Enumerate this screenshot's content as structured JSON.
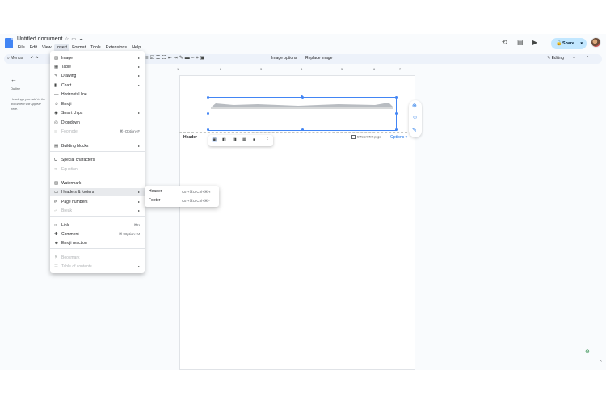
{
  "doc": {
    "title": "Untitled document"
  },
  "menubar": [
    "File",
    "Edit",
    "View",
    "Insert",
    "Format",
    "Tools",
    "Extensions",
    "Help"
  ],
  "share": {
    "label": "Share"
  },
  "toolbar": {
    "menus_label": "Menus",
    "image_options": "Image options",
    "replace_image": "Replace image",
    "mode": "Editing"
  },
  "outline": {
    "label": "Outline",
    "hint": "Headings you add to the document will appear here."
  },
  "ruler": [
    "1",
    "2",
    "3",
    "4",
    "5",
    "6",
    "7"
  ],
  "header_area": {
    "label": "Header",
    "different_first_page": "Different first page",
    "options": "Options"
  },
  "insert_menu": {
    "items": [
      {
        "label": "Image",
        "icon": "image-icon",
        "submenu": true
      },
      {
        "label": "Table",
        "icon": "table-icon",
        "submenu": true
      },
      {
        "label": "Drawing",
        "icon": "drawing-icon",
        "submenu": true
      },
      {
        "label": "Chart",
        "icon": "chart-icon",
        "submenu": true
      },
      {
        "label": "Horizontal line",
        "icon": "horizontal-line-icon"
      },
      {
        "label": "Emoji",
        "icon": "emoji-icon"
      },
      {
        "label": "Smart chips",
        "icon": "smart-chips-icon",
        "submenu": true
      },
      {
        "label": "Dropdown",
        "icon": "dropdown-icon"
      },
      {
        "label": "Footnote",
        "icon": "footnote-icon",
        "shortcut": "⌘+Option+F",
        "disabled": true
      },
      {
        "label": "Building blocks",
        "icon": "building-blocks-icon",
        "submenu": true
      },
      {
        "label": "Special characters",
        "icon": "special-characters-icon"
      },
      {
        "label": "Equation",
        "icon": "equation-icon",
        "disabled": true
      },
      {
        "label": "Watermark",
        "icon": "watermark-icon"
      },
      {
        "label": "Headers & footers",
        "icon": "headers-footers-icon",
        "submenu": true,
        "highlighted": true
      },
      {
        "label": "Page numbers",
        "icon": "page-numbers-icon",
        "submenu": true
      },
      {
        "label": "Break",
        "icon": "break-icon",
        "submenu": true,
        "disabled": true
      },
      {
        "label": "Link",
        "icon": "link-icon",
        "shortcut": "⌘K"
      },
      {
        "label": "Comment",
        "icon": "comment-icon",
        "shortcut": "⌘+Option+M"
      },
      {
        "label": "Emoji reaction",
        "icon": "emoji-reaction-icon"
      },
      {
        "label": "Bookmark",
        "icon": "bookmark-icon",
        "disabled": true
      },
      {
        "label": "Table of contents",
        "icon": "toc-icon",
        "submenu": true,
        "disabled": true
      }
    ]
  },
  "submenu": {
    "items": [
      {
        "label": "Header",
        "shortcut": "Ctrl+⌘O Ctrl+⌘H"
      },
      {
        "label": "Footer",
        "shortcut": "Ctrl+⌘O Ctrl+⌘F"
      }
    ]
  },
  "colors": {
    "accent": "#1a73e8",
    "share_bg": "#c2e7ff",
    "menu_highlight": "#e8eaed"
  }
}
